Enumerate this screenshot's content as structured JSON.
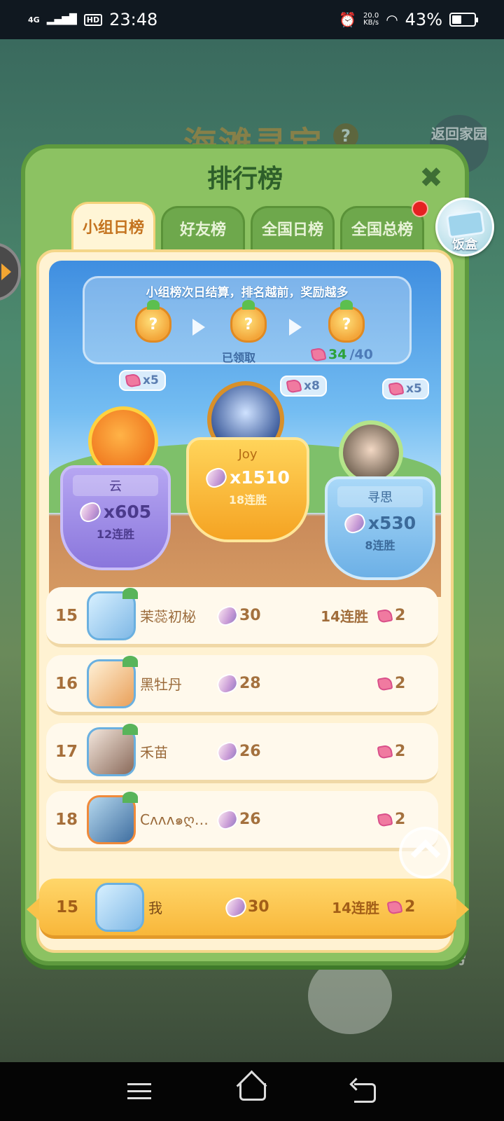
{
  "status_bar": {
    "network": "4G",
    "hd": "HD",
    "time": "23:48",
    "rate_value": "20.0",
    "rate_unit": "KB/s",
    "battery": "43%",
    "battery_level": 0.43
  },
  "background": {
    "title": "海滩寻宝",
    "help": "?",
    "return_label": "返回家园",
    "bottom_label": "榜"
  },
  "panel": {
    "title": "排行榜",
    "close_icon": "close-x-icon",
    "tabs": [
      {
        "label": "小组日榜",
        "active": true
      },
      {
        "label": "好友榜",
        "active": false
      },
      {
        "label": "全国日榜",
        "active": false
      },
      {
        "label": "全国总榜",
        "active": false
      }
    ],
    "chest_label": "饭盒",
    "banner": {
      "text": "小组榜次日结算，排名越前，奖励越多",
      "pineapple_icon": "?",
      "claimed": "已领取",
      "progress_current": "34",
      "progress_total": "/40"
    },
    "podium": {
      "first": {
        "name": "Joy",
        "score": "x1510",
        "streak": "18连胜",
        "reward": "x8"
      },
      "second": {
        "name": "云",
        "score": "x605",
        "streak": "12连胜",
        "reward": "x5"
      },
      "third": {
        "name": "寻思",
        "score": "x530",
        "streak": "8连胜",
        "reward": "x5"
      }
    },
    "rows": [
      {
        "rank": "15",
        "name": "茉蕊初柲",
        "score": "30",
        "streak": "14连胜",
        "reward": "2"
      },
      {
        "rank": "16",
        "name": "黑牡丹",
        "score": "28",
        "streak": "",
        "reward": "2"
      },
      {
        "rank": "17",
        "name": "禾苗",
        "score": "26",
        "streak": "",
        "reward": "2"
      },
      {
        "rank": "18",
        "name": "Cʌʌʌ๑ღ…",
        "score": "26",
        "streak": "",
        "reward": "2"
      }
    ],
    "me": {
      "rank": "15",
      "name": "我",
      "score": "30",
      "streak": "14连胜",
      "reward": "2"
    }
  }
}
